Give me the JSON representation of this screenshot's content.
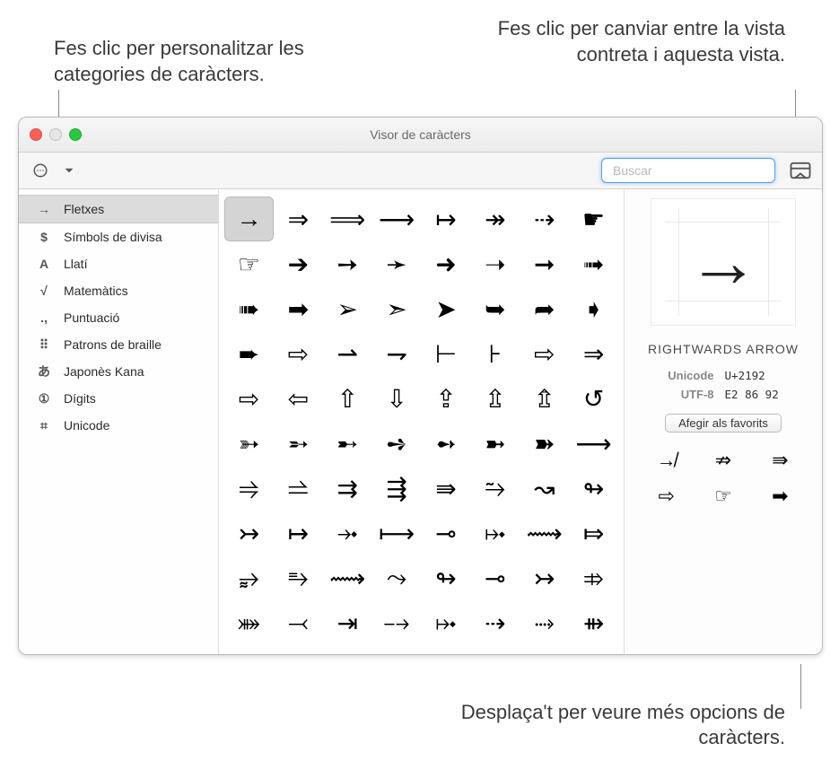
{
  "callouts": {
    "left": "Fes clic per personalitzar les categories de caràcters.",
    "rightTop": "Fes clic per canviar entre la vista contreta i aquesta vista.",
    "bottom": "Desplaça't per veure més opcions de caràcters."
  },
  "window": {
    "title": "Visor de caràcters"
  },
  "search": {
    "placeholder": "Buscar"
  },
  "sidebar": {
    "items": [
      {
        "icon": "→",
        "label": "Fletxes",
        "selected": true
      },
      {
        "icon": "$",
        "label": "Símbols de divisa"
      },
      {
        "icon": "A",
        "label": "Llatí"
      },
      {
        "icon": "√",
        "label": "Matemàtics"
      },
      {
        "icon": ".,",
        "label": "Puntuació"
      },
      {
        "icon": "⠿",
        "label": "Patrons de braille"
      },
      {
        "icon": "あ",
        "label": "Japonès Kana"
      },
      {
        "icon": "①",
        "label": "Dígits"
      },
      {
        "icon": "⌗",
        "label": "Unicode"
      }
    ]
  },
  "grid": {
    "selectedIndex": 0,
    "glyphs": [
      "→",
      "⇒",
      "⟹",
      "⟶",
      "↦",
      "↠",
      "⇢",
      "☛",
      "☞",
      "➔",
      "➙",
      "➛",
      "➜",
      "➝",
      "➞",
      "➟",
      "➠",
      "➡",
      "➢",
      "➣",
      "➤",
      "➥",
      "➦",
      "➧",
      "➨",
      "⇨",
      "⇀",
      "⇁",
      "⊢",
      "⊦",
      "⇨",
      "⇒",
      "⇨",
      "⇦",
      "⇧",
      "⇩",
      "⇪",
      "⇫",
      "⇬",
      "↺",
      "➳",
      "➵",
      "➸",
      "➺",
      "➻",
      "➼",
      "➽",
      "⟶",
      "⥤",
      "⥬",
      "⇉",
      "⇶",
      "⇛",
      "⥲",
      "↝",
      "↬",
      "↣",
      "↦",
      "⤞",
      "⟼",
      "⊸",
      "⤠",
      "⟿",
      "⤇",
      "⥵",
      "⥱",
      "⟿",
      "⤳",
      "↬",
      "⊸",
      "↣",
      "⤃",
      "⤘",
      "⤙",
      "⇥",
      "⤍",
      "⤠",
      "⇢",
      "⤑",
      "⇻"
    ]
  },
  "detail": {
    "glyph": "→",
    "name": "RIGHTWARDS ARROW",
    "unicode_label": "Unicode",
    "unicode_value": "U+2192",
    "utf8_label": "UTF-8",
    "utf8_value": "E2 86 92",
    "favorites_label": "Afegir als favorits",
    "variants": [
      "↛",
      "⇏",
      "⇛",
      "⇨",
      "☞",
      "➡"
    ]
  }
}
